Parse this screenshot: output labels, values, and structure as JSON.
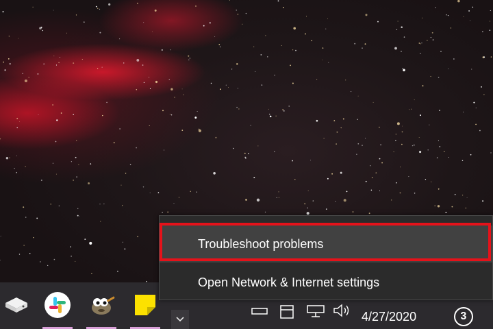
{
  "context_menu": {
    "items": [
      {
        "label": "Troubleshoot problems",
        "state": "hover"
      },
      {
        "label": "Open Network & Internet settings",
        "state": "normal"
      }
    ],
    "highlight_color": "#e5121a"
  },
  "taskbar": {
    "apps": [
      {
        "icon": "drive-icon"
      },
      {
        "icon": "slack-icon"
      },
      {
        "icon": "gimp-icon"
      },
      {
        "icon": "sticky-notes-icon"
      }
    ],
    "tray": {
      "chevron": "chevron-up-icon",
      "icons": [
        "battery-icon",
        "network-icon",
        "monitor-icon",
        "volume-icon"
      ],
      "date": "4/27/2020",
      "notification_count": "3"
    }
  },
  "colors": {
    "taskbar": "#2c2a2e",
    "menu_background": "#2b2b2b",
    "menu_hover": "#414141",
    "app_underline": "#d9a0d8"
  }
}
